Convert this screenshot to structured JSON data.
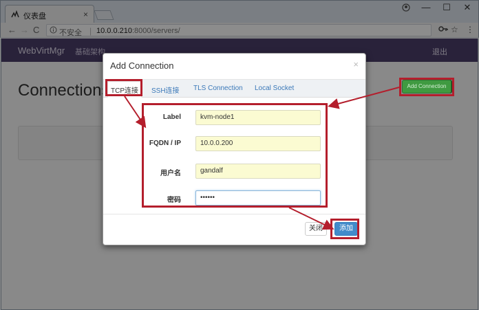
{
  "browser": {
    "tab_title": "仪表盘",
    "tab_close": "×",
    "window_controls": [
      "—",
      "☐",
      "✕"
    ],
    "nav_icons": {
      "back": "←",
      "forward": "→",
      "reload": "C"
    },
    "security_label": "不安全",
    "url_host": "10.0.0.210",
    "url_rest": ":8000/servers/",
    "icons": {
      "key": "key-icon",
      "star": "star-icon",
      "menu": "menu-icon"
    }
  },
  "navbar": {
    "brand": "WebVirtMgr",
    "link": "基础架构",
    "logout": "退出"
  },
  "page": {
    "title": "Connections",
    "add_button": "Add Connection"
  },
  "modal": {
    "title": "Add Connection",
    "close": "×",
    "tabs": [
      "TCP连接",
      "SSH连接",
      "TLS Connection",
      "Local Socket"
    ],
    "fields": [
      {
        "label": "Label",
        "value": "kvm-node1"
      },
      {
        "label": "FQDN / IP",
        "value": "10.0.0.200"
      },
      {
        "label": "用户名",
        "value": "gandalf"
      },
      {
        "label": "密码",
        "value": "••••••"
      }
    ],
    "close_button": "关闭",
    "add_button": "添加"
  },
  "colors": {
    "annotation": "#b41e2c",
    "navbar": "#4c3e6b",
    "primary": "#428bca",
    "success": "#3c8d3e"
  }
}
